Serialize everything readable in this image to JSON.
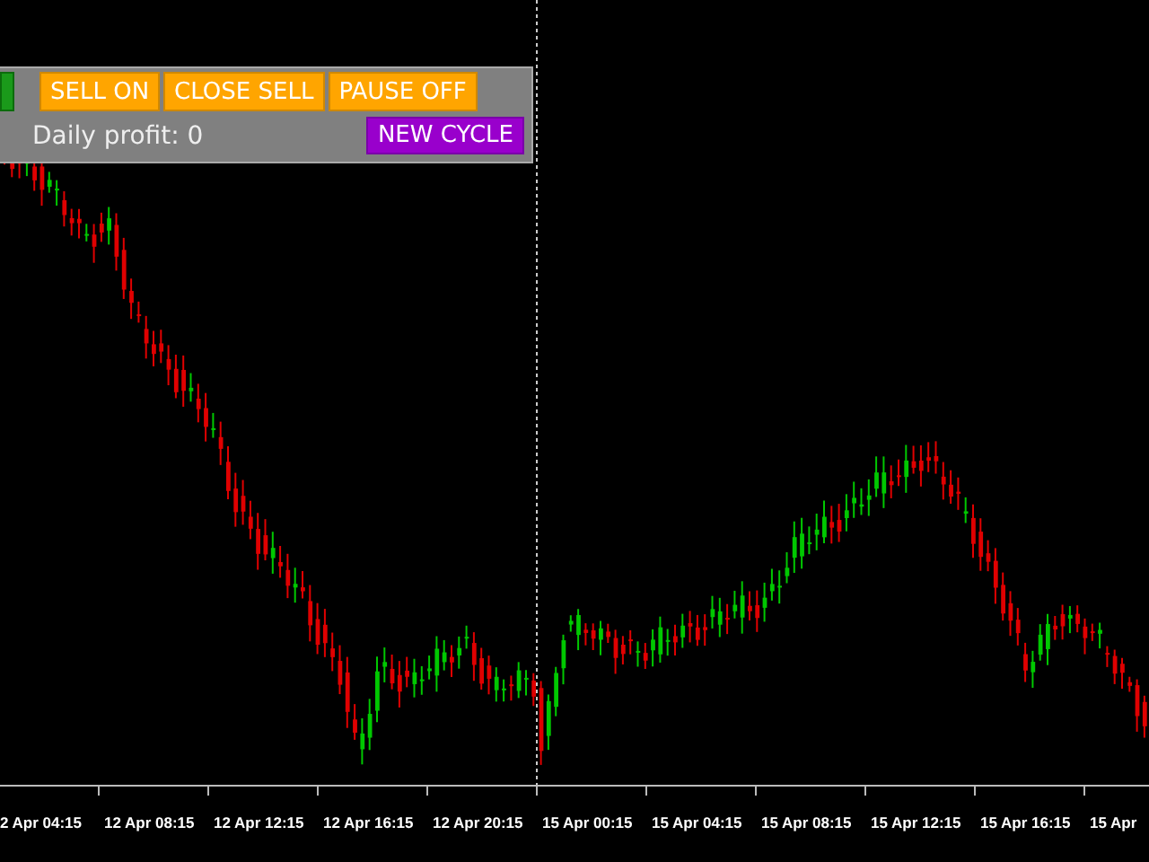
{
  "panel": {
    "top_buttons": [
      {
        "kind": "cut"
      },
      {
        "kind": "action",
        "label": "SELL ON"
      },
      {
        "kind": "action",
        "label": "CLOSE SELL"
      },
      {
        "kind": "action",
        "label": "PAUSE OFF"
      }
    ],
    "profit_label": "Daily profit: 0",
    "cycle_button": {
      "kind": "cycle",
      "label": "NEW CYCLE"
    }
  },
  "time_axis": {
    "labels": [
      "2 Apr 04:15",
      "12 Apr 08:15",
      "12 Apr 12:15",
      "12 Apr 16:15",
      "12 Apr 20:15",
      "15 Apr 00:15",
      "15 Apr 04:15",
      "15 Apr 08:15",
      "15 Apr 12:15",
      "15 Apr 16:15",
      "15 Apr"
    ]
  }
}
